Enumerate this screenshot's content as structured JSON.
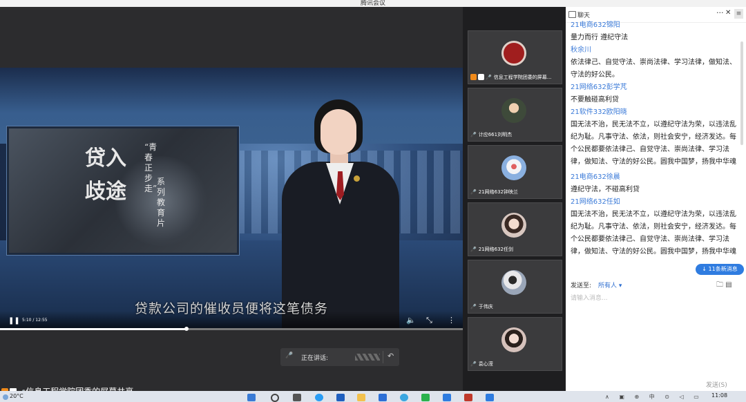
{
  "window": {
    "title": "腾讯会议"
  },
  "video": {
    "subtitle": "贷款公司的催收员便将这笔债务",
    "time": "5:10 / 12:55",
    "progress_fraction": 0.403,
    "poster_big": "贷入歧途",
    "poster_col1": "“青春正步走”",
    "poster_col2": "系列教育片"
  },
  "speaking_bar": {
    "label": "正在讲话:"
  },
  "share_label": "信息工程学院团委的屏幕共享",
  "participants": [
    {
      "name": "信息工程学院团委的屏幕...",
      "avatar_color": "#a01e1e"
    },
    {
      "name": "计应661刘明杰",
      "avatar_color": "#3e4a3a"
    },
    {
      "name": "21网络632钟映兰",
      "avatar_color": "#e8eef6"
    },
    {
      "name": "21网络632任剑",
      "avatar_color": "#d8c7c0"
    },
    {
      "name": "于伟庆",
      "avatar_color": "#c7ccd6"
    },
    {
      "name": "袁心滢",
      "avatar_color": "#d6c2bc"
    }
  ],
  "chat": {
    "title": "聊天",
    "messages": [
      {
        "sender": "21电商632锦阳",
        "text": "量力而行 遵纪守法"
      },
      {
        "sender": "秋余川",
        "text": "依法律己、自觉守法、崇尚法律、学习法律，做知法、守法的好公民。"
      },
      {
        "sender": "21网络632彭学芃",
        "text": "不要触碰高利贷"
      },
      {
        "sender": "21软件332欧阳晓",
        "text": "国无法不治，民无法不立，以遵纪守法为荣，以违法乱纪为耻。凡事守法、依法，则社会安宁，经济发达。每个公民都要依法律己、自觉守法、崇尚法律、学习法律，做知法、守法的好公民。圆我中国梦，扬我中华魂"
      },
      {
        "sender": "21电商632徐晨",
        "text": "遵纪守法，不碰高利贷"
      },
      {
        "sender": "21网络632任如",
        "text": "国无法不治，民无法不立，以遵纪守法为荣，以违法乱纪为耻。凡事守法、依法，则社会安宁，经济发达。每个公民都要依法律己、自觉守法、崇尚法律、学习法律，做知法、守法的好公民。圆我中国梦，扬我中华魂"
      }
    ],
    "new_messages": "↓ 11条新消息",
    "send_to_label": "发送至:",
    "send_to_target": "所有人 ▾",
    "input_placeholder": "请输入消息...",
    "send_button": "发送(S)",
    "more_icon": "···",
    "close_icon": "✕",
    "menu_icon": "≡"
  },
  "taskbar": {
    "temperature": "20°C",
    "time": "11:08",
    "tray": "∧ ▣ ⊕ 中 ⊙ ◁ ▭"
  }
}
